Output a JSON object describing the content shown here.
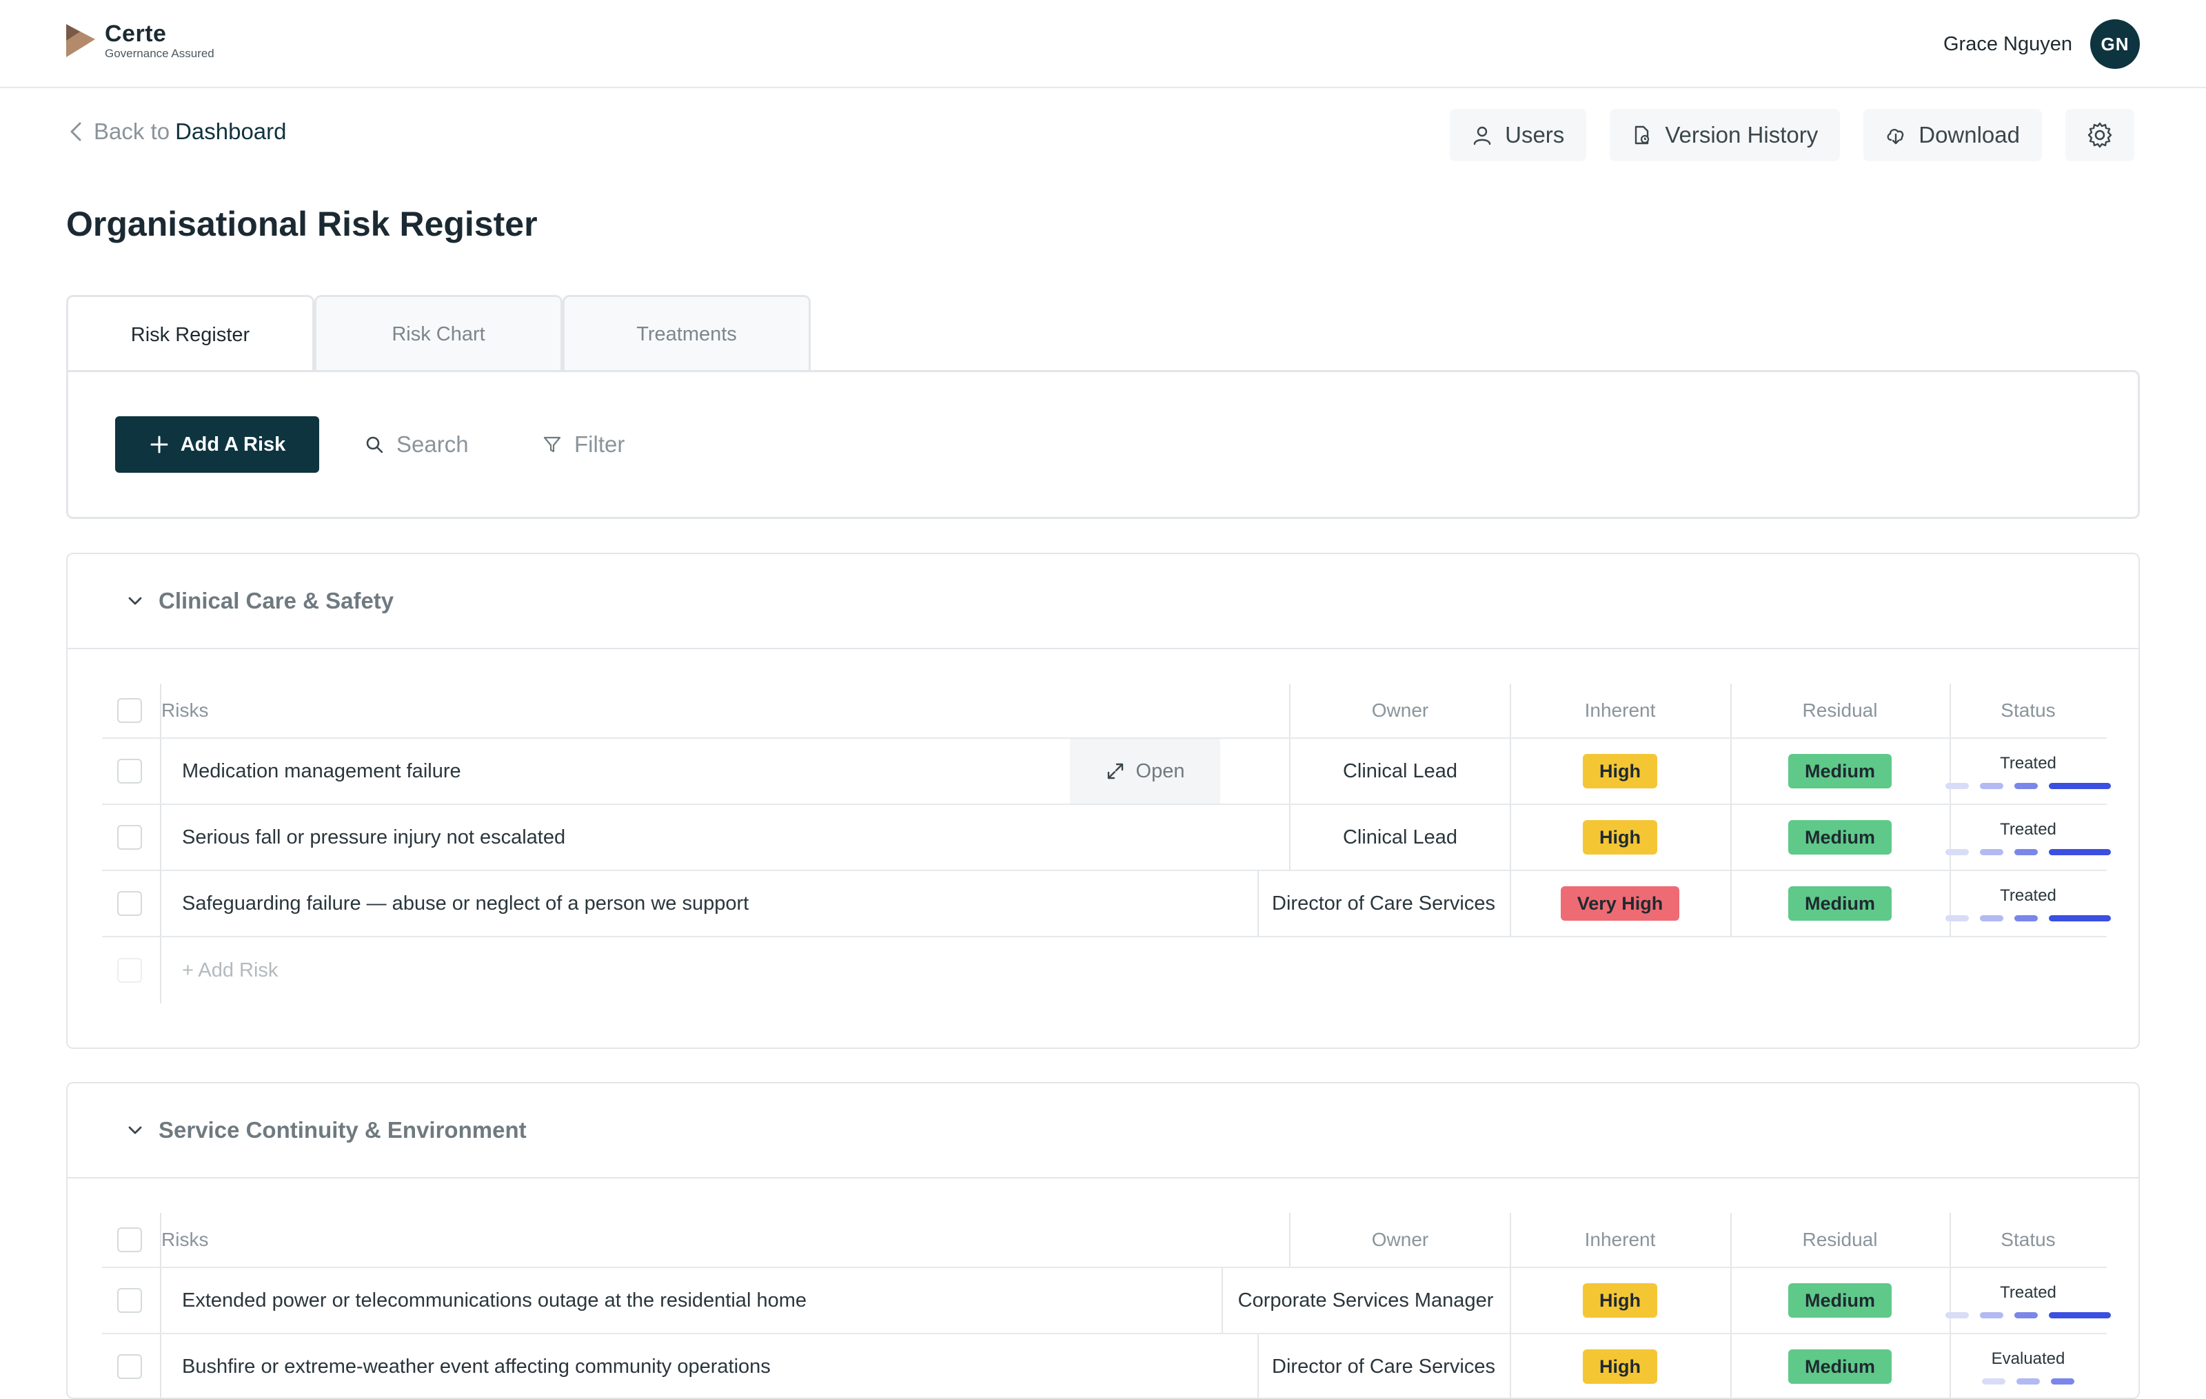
{
  "app": {
    "name": "Certe",
    "tagline": "Governance Assured"
  },
  "user": {
    "name": "Grace Nguyen",
    "initials": "GN"
  },
  "nav": {
    "back_prefix": "Back to",
    "back_link": "Dashboard"
  },
  "actions": {
    "users": "Users",
    "version_history": "Version History",
    "download": "Download"
  },
  "page": {
    "title": "Organisational Risk Register"
  },
  "tabs": [
    {
      "label": "Risk Register",
      "active": true
    },
    {
      "label": "Risk Chart",
      "active": false
    },
    {
      "label": "Treatments",
      "active": false
    }
  ],
  "toolbar": {
    "add_risk": "Add A Risk",
    "search": "Search",
    "filter": "Filter"
  },
  "table_headers": {
    "risks": "Risks",
    "owner": "Owner",
    "inherent": "Inherent",
    "residual": "Residual",
    "status": "Status"
  },
  "open_label": "Open",
  "sections": [
    {
      "title": "Clinical Care & Safety",
      "add_row": "+ Add Risk",
      "rows": [
        {
          "risk": "Medication management failure",
          "owner": "Clinical Lead",
          "inherent": "High",
          "residual": "Medium",
          "status": "Treated"
        },
        {
          "risk": "Serious fall or pressure injury not escalated",
          "owner": "Clinical Lead",
          "inherent": "High",
          "residual": "Medium",
          "status": "Treated"
        },
        {
          "risk": "Safeguarding failure — abuse or neglect of a person we support",
          "owner": "Director of Care Services",
          "inherent": "Very High",
          "residual": "Medium",
          "status": "Treated"
        }
      ]
    },
    {
      "title": "Service Continuity & Environment",
      "rows": [
        {
          "risk": "Extended power or telecommunications outage at the residential home",
          "owner": "Corporate Services Manager",
          "inherent": "High",
          "residual": "Medium",
          "status": "Treated"
        },
        {
          "risk": "Bushfire or extreme-weather event affecting community operations",
          "owner": "Director of Care Services",
          "inherent": "High",
          "residual": "Medium",
          "status": "Evaluated"
        }
      ]
    }
  ],
  "colors": {
    "primary": "#0e3440",
    "high": "#f5c634",
    "very_high": "#ee6b74",
    "medium": "#5fc98a",
    "progress": "#3b4fe0"
  }
}
